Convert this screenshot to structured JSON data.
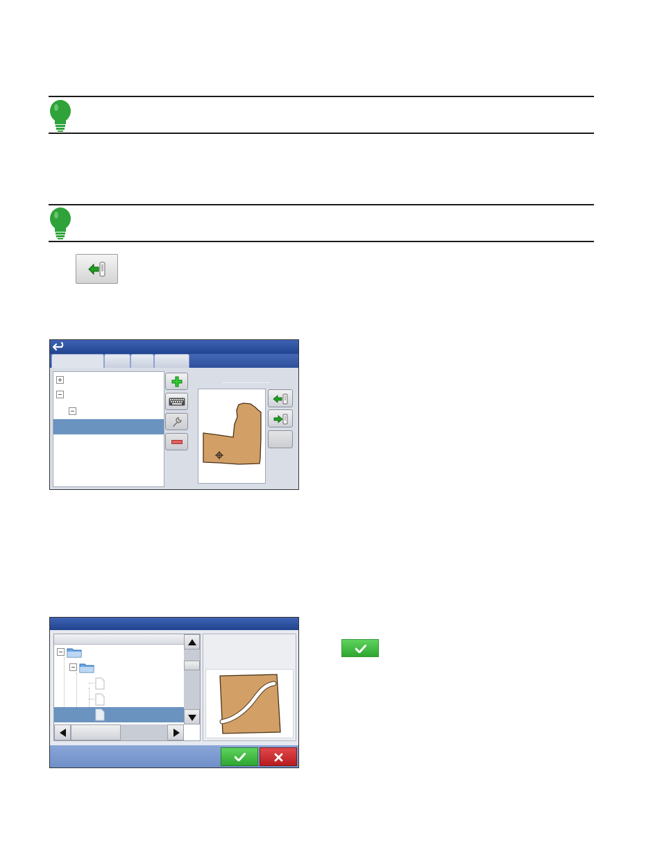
{
  "icons": {
    "bulb": "lightbulb-icon",
    "import_boundary": "import-boundary-icon",
    "export_boundary": "export-boundary-icon",
    "back": "back-arrow-icon",
    "add": "plus-icon",
    "keyboard": "keyboard-icon",
    "wrench": "wrench-icon",
    "remove": "minus-icon",
    "check": "check-icon",
    "close": "x-icon",
    "folder": "folder-icon",
    "file": "file-icon",
    "target": "crosshair-icon"
  },
  "colors": {
    "note_bulb": "#2fa23a",
    "title_bar": "#2b4c9b",
    "selection": "#6a93bf",
    "field_fill": "#d2a066",
    "accept_green": "#3cb83c",
    "cancel_red": "#c8262a"
  }
}
